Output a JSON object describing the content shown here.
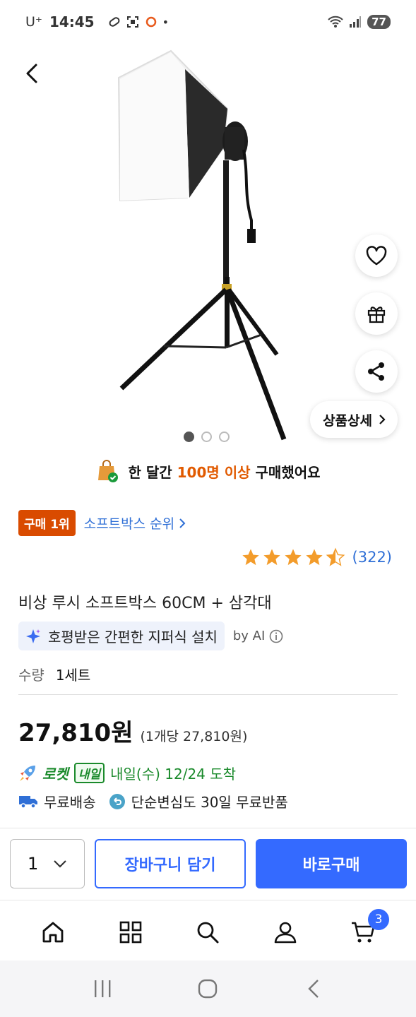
{
  "status_bar": {
    "carrier": "U⁺",
    "time": "14:45",
    "battery": "77"
  },
  "hero": {
    "detail_label": "상품상세",
    "slide_count": 3,
    "active_slide": 0
  },
  "purchase_banner": {
    "prefix": "한 달간",
    "highlight": "100명 이상",
    "suffix": "구매했어요"
  },
  "rank": {
    "badge": "구매 1위",
    "link": "소프트박스 순위"
  },
  "rating": {
    "stars": 4.5,
    "review_count": "(322)"
  },
  "product": {
    "title": "비상 루시 소프트박스 60CM + 삼각대"
  },
  "ai_summary": {
    "text": "호평받은 간편한 지퍼식 설치",
    "by": "by AI"
  },
  "quantity_info": {
    "label": "수량",
    "value": "1세트"
  },
  "price": {
    "amount": "27,810원",
    "unit": "(1개당 27,810원)"
  },
  "delivery": {
    "rocket": "로켓",
    "badge": "내일",
    "arrival": "내일(수) 12/24 도착"
  },
  "shipping": {
    "free_shipping": "무료배송",
    "return_policy": "단순변심도 30일 무료반품"
  },
  "actions": {
    "qty": "1",
    "cart": "장바구니 담기",
    "buy": "바로구매"
  },
  "bottom_nav": {
    "cart_count": "3"
  },
  "colors": {
    "accent": "#346aff",
    "rank_badge": "#d94b00",
    "rocket_green": "#1a8a2b",
    "highlight_orange": "#e15a00"
  }
}
